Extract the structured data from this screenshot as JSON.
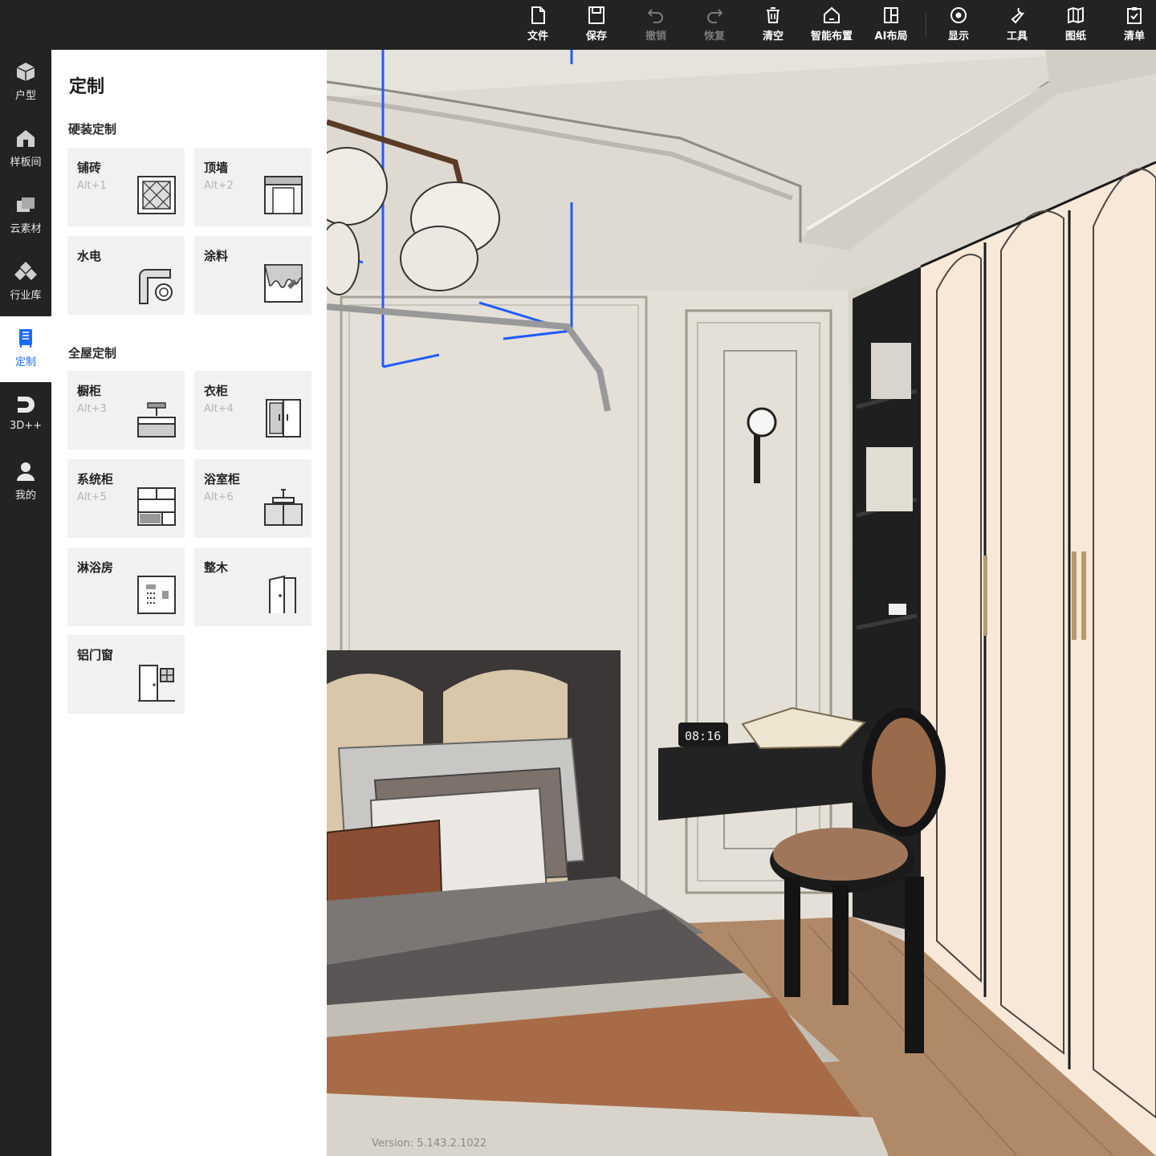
{
  "toolbar": {
    "items": [
      {
        "label": "文件",
        "icon": "file-icon",
        "enabled": true
      },
      {
        "label": "保存",
        "icon": "save-icon",
        "enabled": true
      },
      {
        "label": "撤销",
        "icon": "undo-icon",
        "enabled": false
      },
      {
        "label": "恢复",
        "icon": "redo-icon",
        "enabled": false
      },
      {
        "label": "清空",
        "icon": "clear-icon",
        "enabled": true
      },
      {
        "label": "智能布置",
        "icon": "smart-layout-icon",
        "enabled": true
      },
      {
        "label": "AI布局",
        "icon": "ai-layout-icon",
        "enabled": true
      },
      {
        "label": "显示",
        "icon": "display-icon",
        "enabled": true
      },
      {
        "label": "工具",
        "icon": "tools-icon",
        "enabled": true
      },
      {
        "label": "图纸",
        "icon": "drawings-icon",
        "enabled": true
      },
      {
        "label": "清单",
        "icon": "checklist-icon",
        "enabled": true
      }
    ]
  },
  "sidebar": {
    "items": [
      {
        "label": "户型",
        "icon": "floorplan-icon"
      },
      {
        "label": "样板间",
        "icon": "showroom-icon"
      },
      {
        "label": "云素材",
        "icon": "cloud-material-icon"
      },
      {
        "label": "行业库",
        "icon": "industry-library-icon"
      },
      {
        "label": "定制",
        "icon": "custom-icon",
        "active": true
      },
      {
        "label": "3D++",
        "icon": "3d-plus-icon"
      },
      {
        "label": "我的",
        "icon": "user-icon"
      }
    ],
    "active_color": "#1e6bff"
  },
  "panel": {
    "title": "定制",
    "hard_section": {
      "title": "硬装定制",
      "cards": [
        {
          "name": "铺砖",
          "shortcut": "Alt+1",
          "icon": "tile-icon"
        },
        {
          "name": "顶墙",
          "shortcut": "Alt+2",
          "icon": "ceiling-wall-icon"
        },
        {
          "name": "水电",
          "shortcut": "",
          "icon": "plumbing-electric-icon"
        },
        {
          "name": "涂料",
          "shortcut": "",
          "icon": "paint-icon"
        }
      ]
    },
    "whole_section": {
      "title": "全屋定制",
      "cards": [
        {
          "name": "橱柜",
          "shortcut": "Alt+3",
          "icon": "kitchen-cabinet-icon"
        },
        {
          "name": "衣柜",
          "shortcut": "Alt+4",
          "icon": "wardrobe-icon"
        },
        {
          "name": "系统柜",
          "shortcut": "Alt+5",
          "icon": "system-cabinet-icon"
        },
        {
          "name": "浴室柜",
          "shortcut": "Alt+6",
          "icon": "bathroom-cabinet-icon"
        },
        {
          "name": "淋浴房",
          "shortcut": "",
          "icon": "shower-room-icon"
        },
        {
          "name": "整木",
          "shortcut": "",
          "icon": "whole-wood-icon"
        },
        {
          "name": "铝门窗",
          "shortcut": "",
          "icon": "aluminum-window-icon"
        }
      ]
    }
  },
  "viewport": {
    "version": "Version: 5.143.2.1022",
    "clock": "08:16"
  }
}
